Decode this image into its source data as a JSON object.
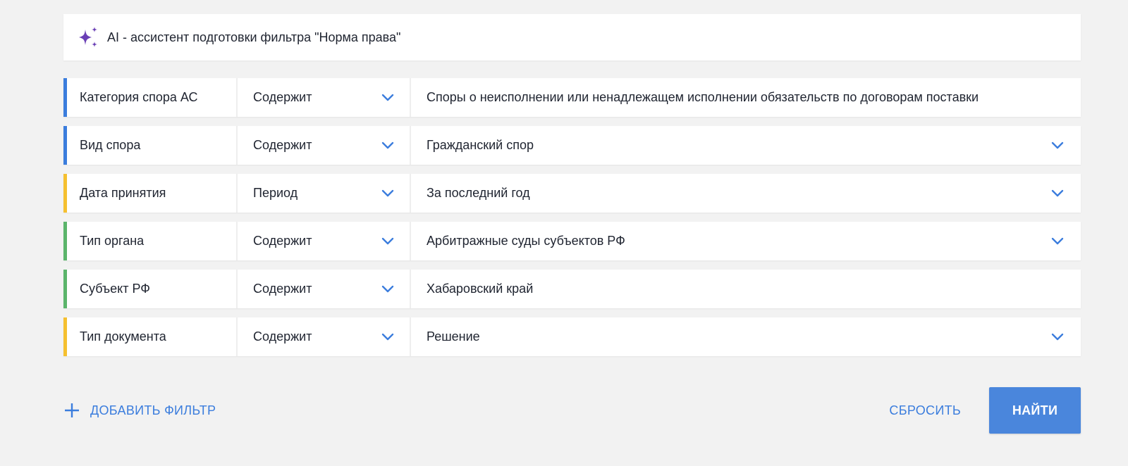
{
  "ai_banner": {
    "title": "AI - ассистент подготовки фильтра \"Норма права\"",
    "icon": "sparkle-icon",
    "icon_color": "#6a3fb5"
  },
  "filters": [
    {
      "field": "Категория спора АС",
      "operator": "Содержит",
      "value": "Споры о неисполнении или ненадлежащем исполнении обязательств по договорам поставки",
      "value_has_dropdown": false,
      "accent_color": "#3b7ddd"
    },
    {
      "field": "Вид спора",
      "operator": "Содержит",
      "value": "Гражданский спор",
      "value_has_dropdown": true,
      "accent_color": "#3b7ddd"
    },
    {
      "field": "Дата принятия",
      "operator": "Период",
      "value": "За последний год",
      "value_has_dropdown": true,
      "accent_color": "#f5c030"
    },
    {
      "field": "Тип органа",
      "operator": "Содержит",
      "value": "Арбитражные суды субъектов РФ",
      "value_has_dropdown": true,
      "accent_color": "#5bb56b"
    },
    {
      "field": "Субъект РФ",
      "operator": "Содержит",
      "value": "Хабаровский край",
      "value_has_dropdown": false,
      "accent_color": "#5bb56b"
    },
    {
      "field": "Тип документа",
      "operator": "Содержит",
      "value": "Решение",
      "value_has_dropdown": true,
      "accent_color": "#f5c030"
    }
  ],
  "footer": {
    "add_filter_label": "ДОБАВИТЬ ФИЛЬТР",
    "reset_label": "СБРОСИТЬ",
    "find_label": "НАЙТИ"
  },
  "colors": {
    "accent_blue": "#3b7ddd",
    "button_blue": "#4a86dc",
    "background": "#f2f2f2"
  }
}
